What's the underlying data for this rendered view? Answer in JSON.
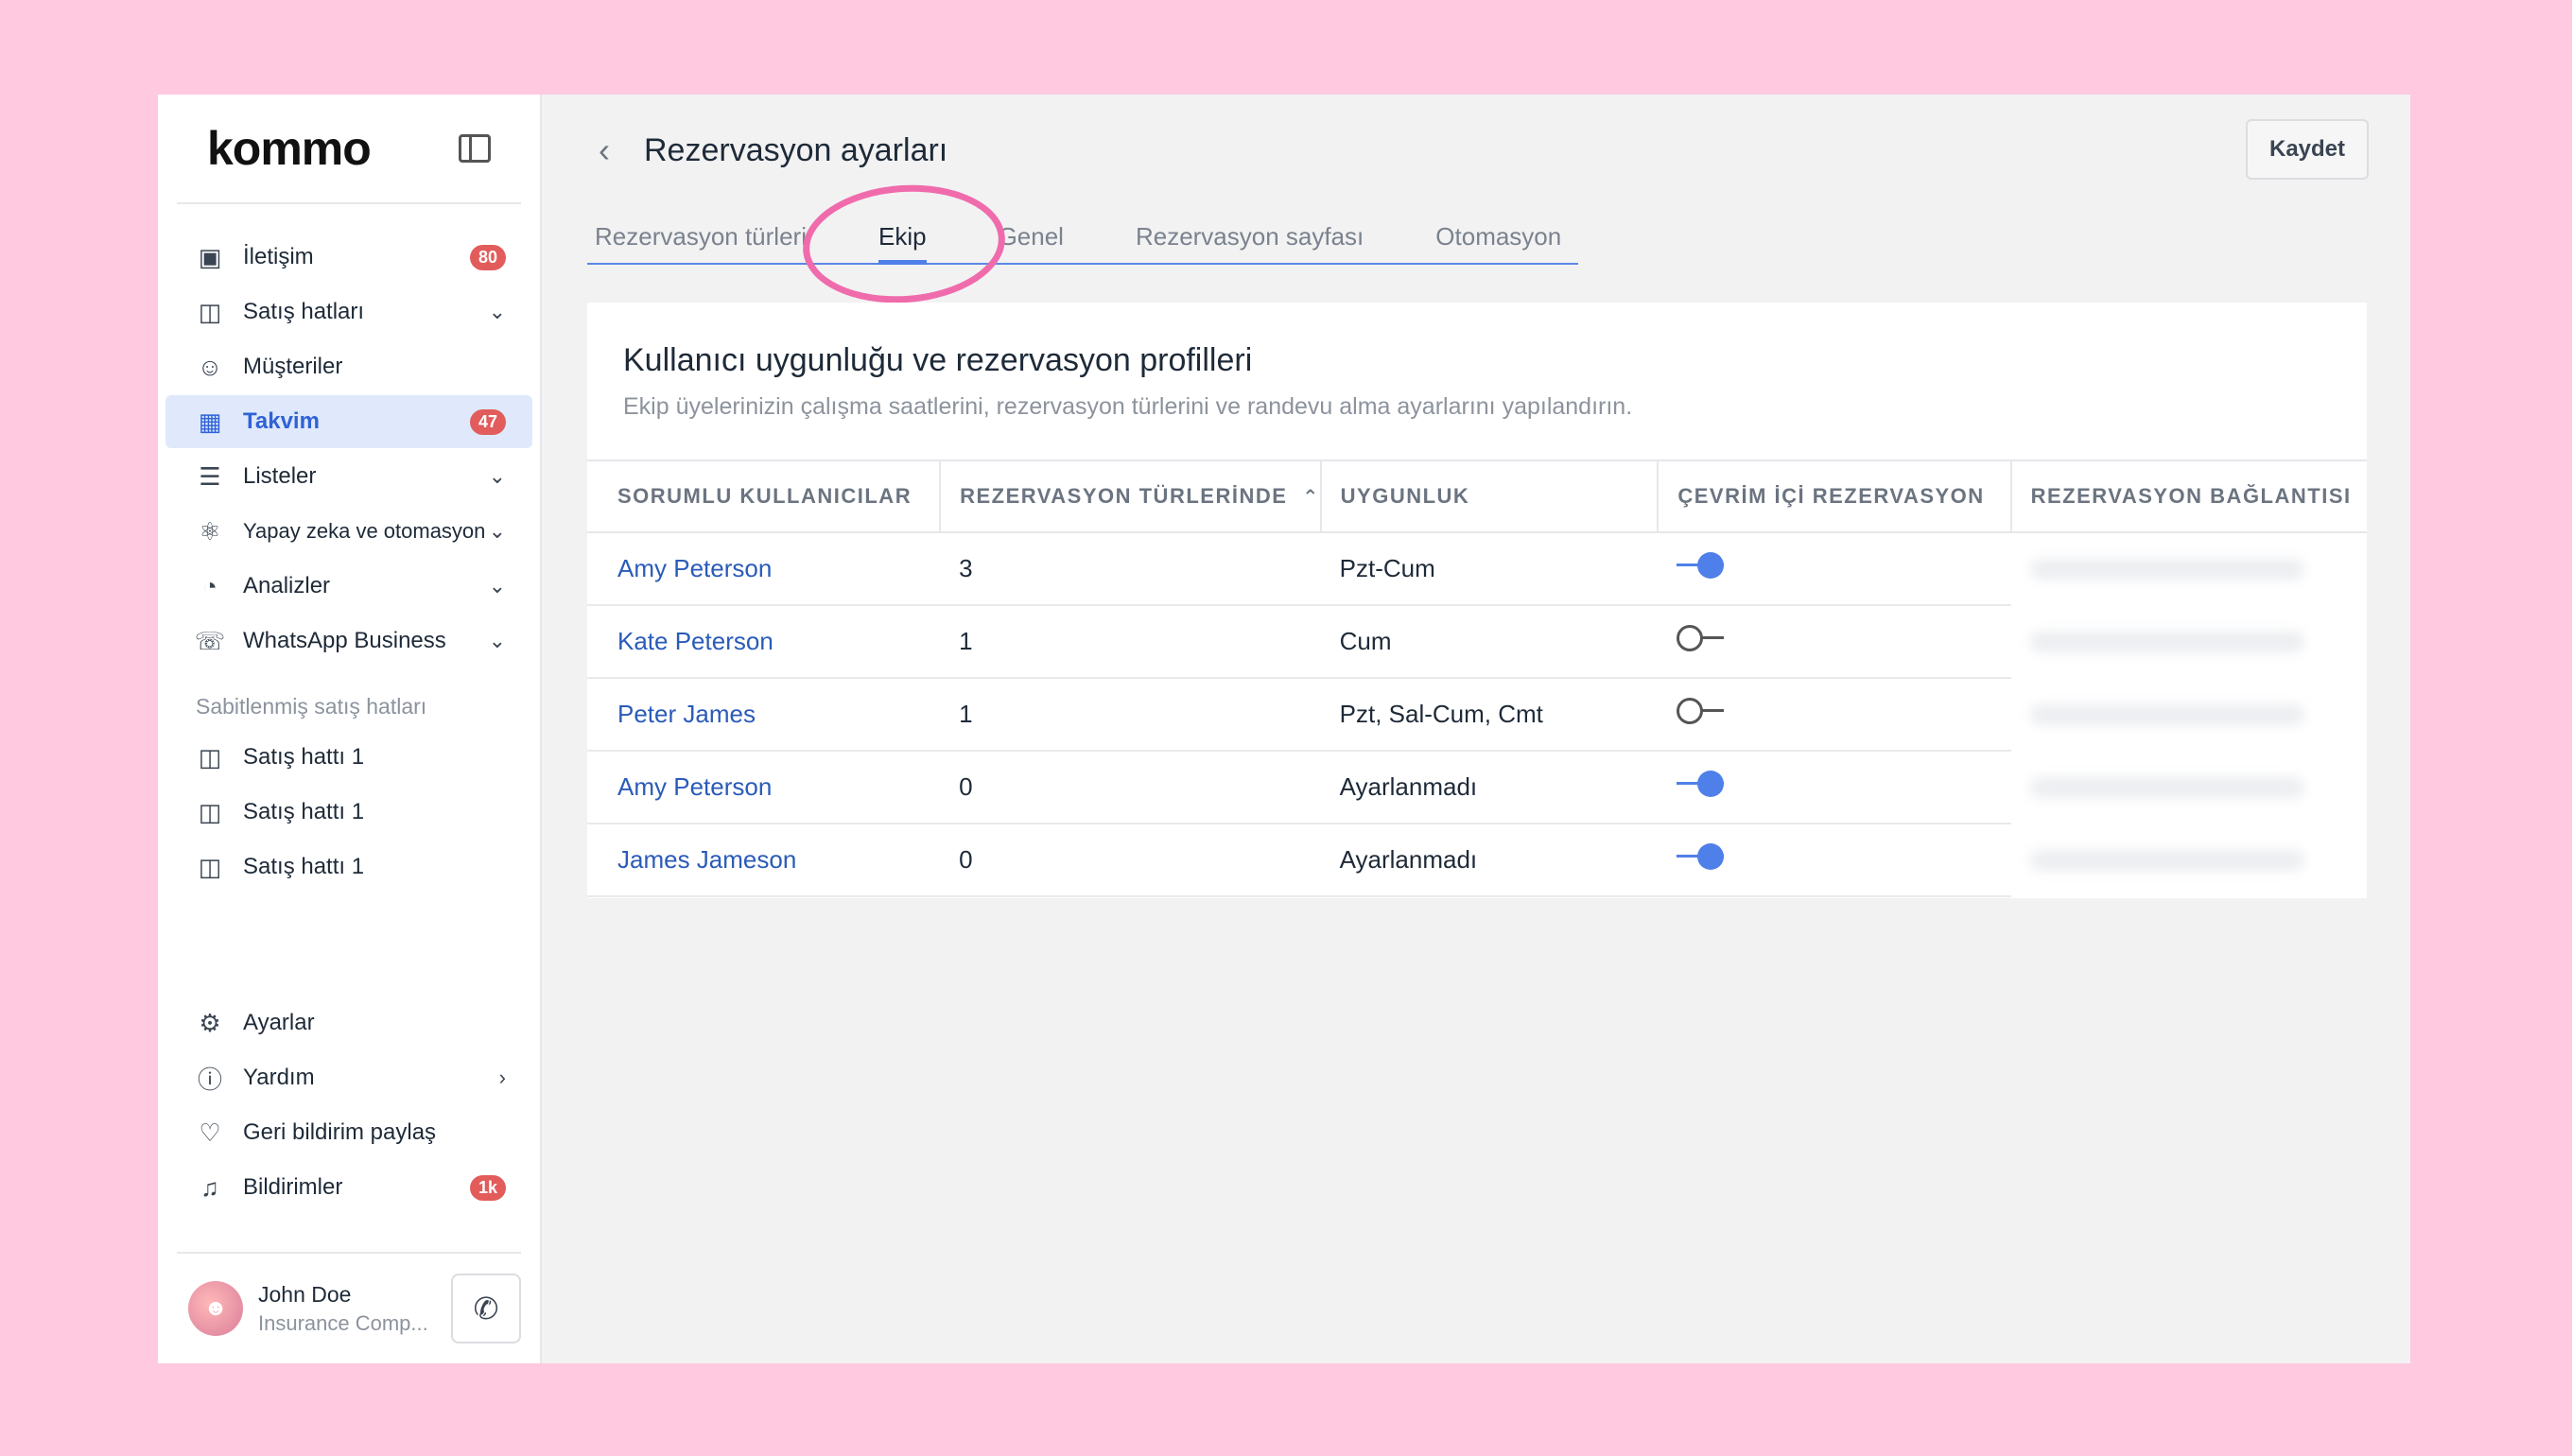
{
  "colors": {
    "accent": "#4f7fe8",
    "badge": "#e25c5c",
    "highlight_ring": "#f06bac",
    "background": "#ffc9e0"
  },
  "sidebar": {
    "logo": "kommo",
    "items": [
      {
        "label": "İletişim",
        "icon": "chat-icon",
        "badge": "80"
      },
      {
        "label": "Satış hatları",
        "icon": "pipeline-icon",
        "chevron": "down"
      },
      {
        "label": "Müşteriler",
        "icon": "users-icon"
      },
      {
        "label": "Takvim",
        "icon": "calendar-icon",
        "badge": "47",
        "active": true
      },
      {
        "label": "Listeler",
        "icon": "list-icon",
        "chevron": "down"
      },
      {
        "label": "Yapay zeka ve otomasyon",
        "icon": "automation-icon",
        "chevron": "down"
      },
      {
        "label": "Analizler",
        "icon": "chart-icon",
        "chevron": "down"
      },
      {
        "label": "WhatsApp Business",
        "icon": "whatsapp-icon",
        "chevron": "down"
      }
    ],
    "pinned_label": "Sabitlenmiş satış hatları",
    "pinned": [
      {
        "label": "Satış hattı 1"
      },
      {
        "label": "Satış hattı 1"
      },
      {
        "label": "Satış hattı 1"
      }
    ],
    "bottom": [
      {
        "label": "Ayarlar",
        "icon": "gear-icon"
      },
      {
        "label": "Yardım",
        "icon": "help-icon",
        "chevron": "right"
      },
      {
        "label": "Geri bildirim paylaş",
        "icon": "heart-icon"
      },
      {
        "label": "Bildirimler",
        "icon": "bell-icon",
        "badge": "1k"
      }
    ],
    "user": {
      "name": "John Doe",
      "company": "Insurance Comp..."
    }
  },
  "header": {
    "title": "Rezervasyon ayarları",
    "save_label": "Kaydet"
  },
  "tabs": [
    {
      "label": "Rezervasyon türleri"
    },
    {
      "label": "Ekip",
      "active": true
    },
    {
      "label": "Genel"
    },
    {
      "label": "Rezervasyon sayfası"
    },
    {
      "label": "Otomasyon"
    }
  ],
  "card": {
    "title": "Kullanıcı uygunluğu ve rezervasyon profilleri",
    "subtitle": "Ekip üyelerinizin çalışma saatlerini, rezervasyon türlerini ve randevu alma ayarlarını yapılandırın."
  },
  "table": {
    "columns": [
      "SORUMLU KULLANICILAR",
      "REZERVASYON TÜRLERİNDE",
      "UYGUNLUK",
      "ÇEVRİM İÇİ REZERVASYON",
      "REZERVASYON BAĞLANTISI"
    ],
    "rows": [
      {
        "user": "Amy Peterson",
        "count": "3",
        "availability": "Pzt-Cum",
        "online": true
      },
      {
        "user": "Kate Peterson",
        "count": "1",
        "availability": "Cum",
        "online": false
      },
      {
        "user": "Peter James",
        "count": "1",
        "availability": "Pzt, Sal-Cum, Cmt",
        "online": false
      },
      {
        "user": "Amy Peterson",
        "count": "0",
        "availability": "Ayarlanmadı",
        "online": true
      },
      {
        "user": "James Jameson",
        "count": "0",
        "availability": "Ayarlanmadı",
        "online": true
      }
    ]
  }
}
